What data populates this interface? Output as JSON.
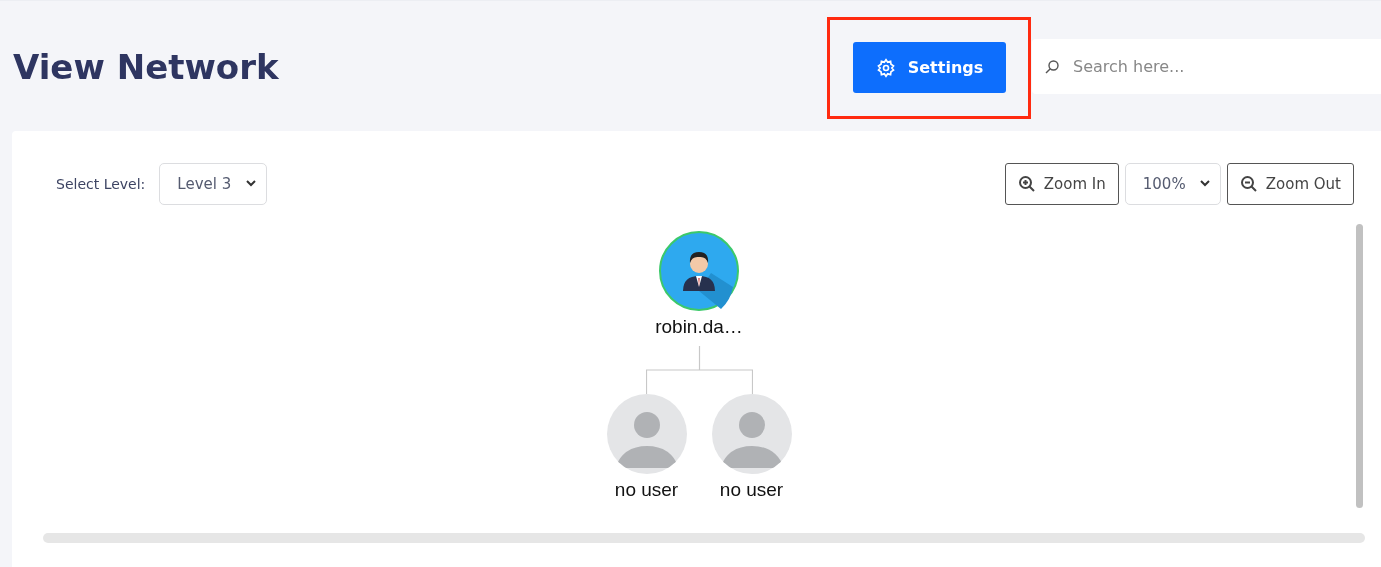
{
  "page": {
    "title": "View Network"
  },
  "settings_button": {
    "label": "Settings",
    "highlighted": true
  },
  "search": {
    "placeholder": "Search here..."
  },
  "level_select": {
    "label": "Select Level:",
    "value": "Level 3"
  },
  "zoom": {
    "zoom_in": "Zoom In",
    "value": "100%",
    "zoom_out": "Zoom Out"
  },
  "tree": {
    "name": "robin.da…",
    "kind": "user",
    "children": [
      {
        "name": "no user",
        "kind": "empty"
      },
      {
        "name": "no user",
        "kind": "empty"
      }
    ]
  }
}
